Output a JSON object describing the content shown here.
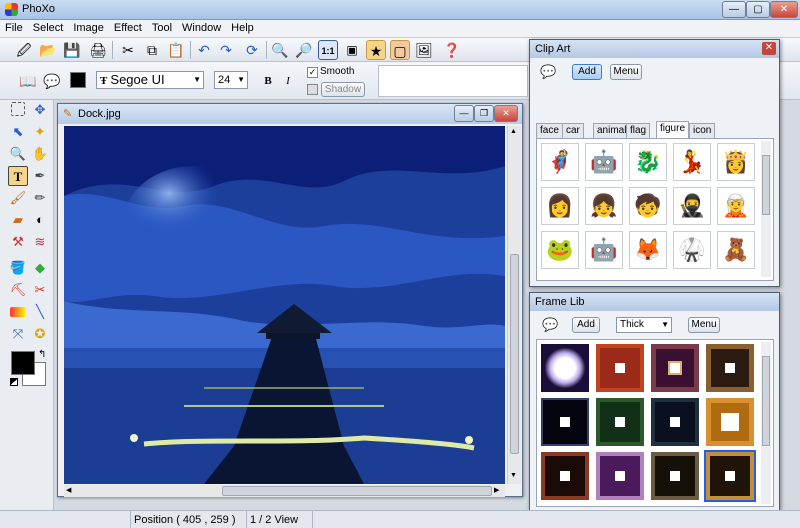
{
  "app": {
    "title": "PhoXo"
  },
  "menu": [
    "File",
    "Select",
    "Image",
    "Effect",
    "Tool",
    "Window",
    "Help"
  ],
  "text_toolbar": {
    "font": "Segoe UI",
    "size": "24",
    "bold": "B",
    "italic": "I",
    "smooth_label": "Smooth",
    "smooth_checked": true,
    "shadow_label": "Shadow",
    "shadow_checked": false
  },
  "document": {
    "title": "Dock.jpg"
  },
  "clipart": {
    "title": "Clip Art",
    "add": "Add",
    "menu": "Menu",
    "tabs": [
      "face",
      "car",
      "animal",
      "flag",
      "figure",
      "icon"
    ],
    "selected_tab": "figure",
    "icons": [
      "🦸",
      "🤖",
      "🐉",
      "💃",
      "👸",
      "👩",
      "👧",
      "🧒",
      "🥷",
      "🧝",
      "🐸",
      "🤖",
      "🦊",
      "🥋",
      "🧸",
      "⛄",
      "🐇",
      "🐇",
      "🐇",
      "👻"
    ]
  },
  "framelib": {
    "title": "Frame Lib",
    "add": "Add",
    "style": "Thick",
    "menu": "Menu"
  },
  "status": {
    "position": "Position ( 405 , 259 )",
    "view": "1 / 2 View"
  },
  "colors": {
    "foreground": "#000000",
    "background": "#ffffff"
  }
}
